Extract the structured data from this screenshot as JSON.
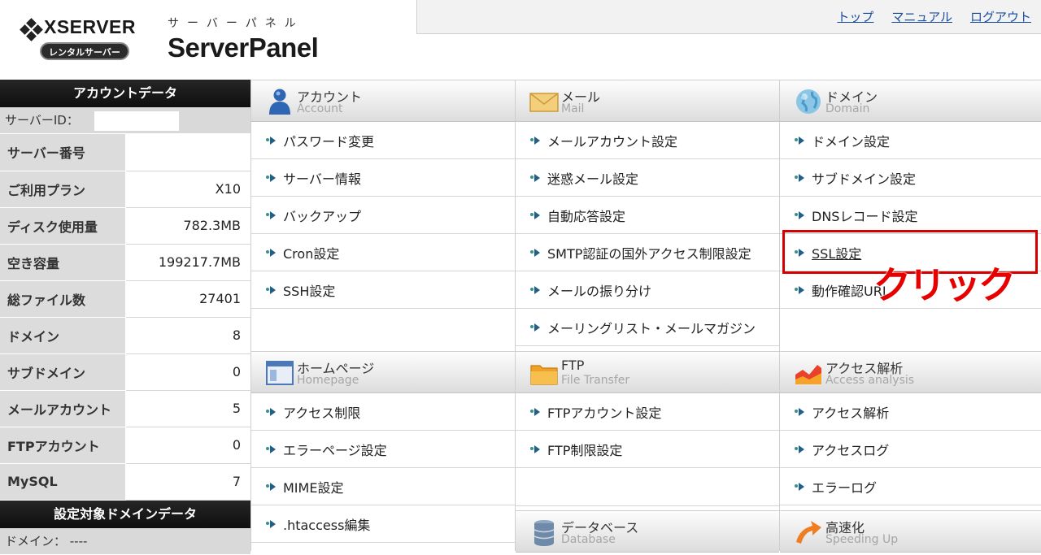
{
  "header": {
    "logo_word": "XSERVER",
    "logo_pill": "レンタルサーバー",
    "panel_kana": "サーバーパネル",
    "panel_title": "ServerPanel",
    "links": {
      "top": "トップ",
      "manual": "マニュアル",
      "logout": "ログアウト"
    }
  },
  "sidebar": {
    "account_heading": "アカウントデータ",
    "server_id_label": "サーバーID：",
    "rows": [
      {
        "label": "サーバー番号",
        "value": ""
      },
      {
        "label": "ご利用プラン",
        "value": "X10"
      },
      {
        "label": "ディスク使用量",
        "value": "782.3MB"
      },
      {
        "label": "空き容量",
        "value": "199217.7MB"
      },
      {
        "label": "総ファイル数",
        "value": "27401"
      },
      {
        "label": "ドメイン",
        "value": "8"
      },
      {
        "label": "サブドメイン",
        "value": "0"
      },
      {
        "label": "メールアカウント",
        "value": "5"
      },
      {
        "label": "FTPアカウント",
        "value": "0"
      },
      {
        "label": "MySQL",
        "value": "7"
      }
    ],
    "domain_heading": "設定対象ドメインデータ",
    "domain_label": "ドメイン： ----"
  },
  "sections": {
    "account": {
      "jp": "アカウント",
      "en": "Account",
      "items": [
        "パスワード変更",
        "サーバー情報",
        "バックアップ",
        "Cron設定",
        "SSH設定"
      ]
    },
    "mail": {
      "jp": "メール",
      "en": "Mail",
      "items": [
        "メールアカウント設定",
        "迷惑メール設定",
        "自動応答設定",
        "SMTP認証の国外アクセス制限設定",
        "メールの振り分け",
        "メーリングリスト・メールマガジン"
      ]
    },
    "domain": {
      "jp": "ドメイン",
      "en": "Domain",
      "items": [
        "ドメイン設定",
        "サブドメイン設定",
        "DNSレコード設定",
        "SSL設定",
        "動作確認URL"
      ]
    },
    "homepage": {
      "jp": "ホームページ",
      "en": "Homepage",
      "items": [
        "アクセス制限",
        "エラーページ設定",
        "MIME設定",
        ".htaccess編集"
      ]
    },
    "ftp": {
      "jp": "FTP",
      "en": "File Transfer",
      "items": [
        "FTPアカウント設定",
        "FTP制限設定"
      ]
    },
    "access": {
      "jp": "アクセス解析",
      "en": "Access analysis",
      "items": [
        "アクセス解析",
        "アクセスログ",
        "エラーログ"
      ]
    },
    "database": {
      "jp": "データベース",
      "en": "Database"
    },
    "speed": {
      "jp": "高速化",
      "en": "Speeding Up"
    }
  },
  "annotation": {
    "click_label": "クリック",
    "color": "#e60000"
  }
}
